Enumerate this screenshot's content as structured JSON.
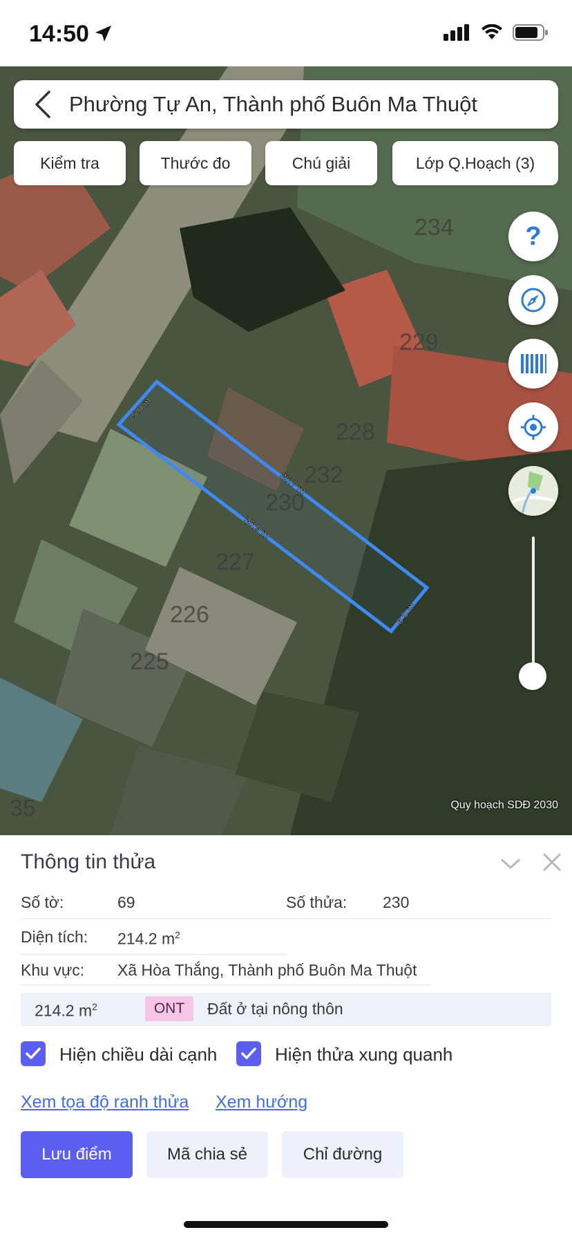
{
  "status_bar": {
    "time": "14:50"
  },
  "search": {
    "title": "Phường Tự An, Thành phố Buôn Ma Thuột"
  },
  "toolbar": {
    "buttons": [
      "Kiểm tra",
      "Thước đo",
      "Chú giải",
      "Lớp Q.Hoạch (3)"
    ]
  },
  "map": {
    "parcel_numbers": [
      "234",
      "229",
      "228",
      "232",
      "230",
      "227",
      "226",
      "225",
      "35"
    ],
    "edge_lengths": [
      "5.0 m",
      "35.7 m",
      "35.9 m",
      "6.0 m"
    ],
    "watermark": "Quy hoạch SDĐ 2030",
    "fab_icons": [
      "help-icon",
      "compass-icon",
      "layers-icon",
      "locate-icon",
      "map-thumbnail-icon"
    ],
    "zoom_level": 0.9
  },
  "panel": {
    "title": "Thông tin thửa",
    "so_to_label": "Số tờ:",
    "so_to_value": "69",
    "so_thua_label": "Số thửa:",
    "so_thua_value": "230",
    "dien_tich_label": "Diện tích:",
    "dien_tich_value": "214.2 m",
    "dien_tich_unit_sup": "2",
    "khu_vuc_label": "Khu vực:",
    "khu_vuc_value": "Xã Hòa Thắng, Thành phố Buôn Ma Thuột",
    "land_use": {
      "area": "214.2 m",
      "area_sup": "2",
      "code": "ONT",
      "description": "Đất ở tại nông thôn"
    },
    "checkbox_1": "Hiện chiều dài cạnh",
    "checkbox_2": "Hiện thửa xung quanh",
    "link_1": "Xem tọa độ ranh thửa",
    "link_2": "Xem hướng",
    "btn_save": "Lưu điểm",
    "btn_share": "Mã chia sẻ",
    "btn_directions": "Chỉ đường"
  },
  "colors": {
    "accent": "#5b5ef0",
    "parcel_outline": "#3d8bf2",
    "link": "#3f6ee8",
    "ont_badge": "#f7c6e6"
  }
}
